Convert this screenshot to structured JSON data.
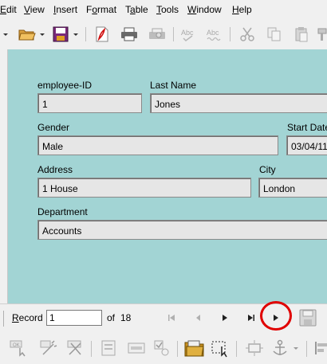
{
  "menu": {
    "edit": {
      "u": "E",
      "rest": "dit"
    },
    "view": {
      "u": "V",
      "rest": "iew"
    },
    "insert": {
      "u": "I",
      "rest": "nsert"
    },
    "format": {
      "pre": "F",
      "u": "o",
      "rest": "rmat"
    },
    "table": {
      "pre": "T",
      "u": "a",
      "rest": "ble"
    },
    "tools": {
      "u": "T",
      "rest": "ools"
    },
    "window": {
      "u": "W",
      "rest": "indow"
    },
    "help": {
      "u": "H",
      "rest": "elp"
    }
  },
  "form": {
    "employee_id": {
      "label": "employee-ID",
      "value": "1"
    },
    "last_name": {
      "label": "Last Name",
      "value": "Jones"
    },
    "gender": {
      "label": "Gender",
      "value": "Male"
    },
    "start_date": {
      "label": "Start Date",
      "value": "03/04/11"
    },
    "address": {
      "label": "Address",
      "value": "1 House"
    },
    "city": {
      "label": "City",
      "value": "London"
    },
    "department": {
      "label": "Department",
      "value": "Accounts"
    }
  },
  "navigation": {
    "record_label_u": "R",
    "record_label_rest": "ecord",
    "record_value": "1",
    "of_label": "of",
    "total_records": "18"
  },
  "colors": {
    "form_background": "#a2d4d4",
    "highlight_circle": "#e00000"
  }
}
